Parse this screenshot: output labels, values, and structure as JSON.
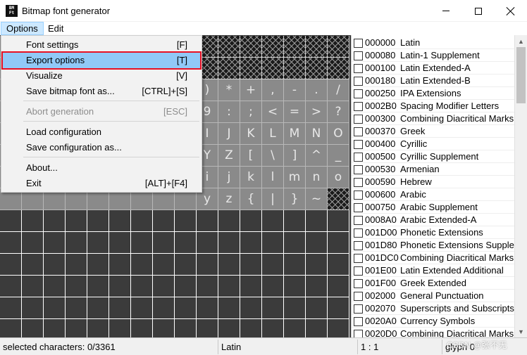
{
  "window": {
    "title": "Bitmap font generator",
    "icon_text": "BM\nFont"
  },
  "menubar": {
    "options": "Options",
    "edit": "Edit"
  },
  "dropdown": {
    "items": [
      {
        "label": "Font settings",
        "shortcut": "[F]",
        "disabled": false,
        "highlighted": false
      },
      {
        "label": "Export options",
        "shortcut": "[T]",
        "disabled": false,
        "highlighted": true
      },
      {
        "label": "Visualize",
        "shortcut": "[V]",
        "disabled": false,
        "highlighted": false
      },
      {
        "label": "Save bitmap font as...",
        "shortcut": "[CTRL]+[S]",
        "disabled": false,
        "highlighted": false
      },
      {
        "label": "Abort generation",
        "shortcut": "[ESC]",
        "disabled": true,
        "highlighted": false
      },
      {
        "label": "Load configuration",
        "shortcut": "",
        "disabled": false,
        "highlighted": false
      },
      {
        "label": "Save configuration as...",
        "shortcut": "",
        "disabled": false,
        "highlighted": false
      },
      {
        "label": "About...",
        "shortcut": "",
        "disabled": false,
        "highlighted": false
      },
      {
        "label": "Exit",
        "shortcut": "[ALT]+[F4]",
        "disabled": false,
        "highlighted": false
      }
    ]
  },
  "grid": {
    "visible_glyph_rows": [
      [
        ")",
        "*",
        "+",
        ",",
        "-",
        ".",
        "/"
      ],
      [
        "9",
        ":",
        ";",
        "<",
        "=",
        ">",
        "?"
      ],
      [
        "I",
        "J",
        "K",
        "L",
        "M",
        "N",
        "O"
      ],
      [
        "Y",
        "Z",
        "[",
        "\\",
        "]",
        "^",
        "_"
      ],
      [
        "i",
        "j",
        "k",
        "l",
        "m",
        "n",
        "o"
      ],
      [
        "y",
        "z",
        "{",
        "|",
        "}",
        "~",
        ""
      ]
    ]
  },
  "unicode_list": [
    {
      "code": "000000",
      "name": "Latin"
    },
    {
      "code": "000080",
      "name": "Latin-1 Supplement"
    },
    {
      "code": "000100",
      "name": "Latin Extended-A"
    },
    {
      "code": "000180",
      "name": "Latin Extended-B"
    },
    {
      "code": "000250",
      "name": "IPA Extensions"
    },
    {
      "code": "0002B0",
      "name": "Spacing Modifier Letters"
    },
    {
      "code": "000300",
      "name": "Combining Diacritical Marks"
    },
    {
      "code": "000370",
      "name": "Greek"
    },
    {
      "code": "000400",
      "name": "Cyrillic"
    },
    {
      "code": "000500",
      "name": "Cyrillic Supplement"
    },
    {
      "code": "000530",
      "name": "Armenian"
    },
    {
      "code": "000590",
      "name": "Hebrew"
    },
    {
      "code": "000600",
      "name": "Arabic"
    },
    {
      "code": "000750",
      "name": "Arabic Supplement"
    },
    {
      "code": "0008A0",
      "name": "Arabic Extended-A"
    },
    {
      "code": "001D00",
      "name": "Phonetic Extensions"
    },
    {
      "code": "001D80",
      "name": "Phonetic Extensions Supple..."
    },
    {
      "code": "001DC0",
      "name": "Combining Diacritical Marks"
    },
    {
      "code": "001E00",
      "name": "Latin Extended Additional"
    },
    {
      "code": "001F00",
      "name": "Greek Extended"
    },
    {
      "code": "002000",
      "name": "General Punctuation"
    },
    {
      "code": "002070",
      "name": "Superscripts and Subscripts"
    },
    {
      "code": "0020A0",
      "name": "Currency Symbols"
    },
    {
      "code": "0020D0",
      "name": "Combining Diacritical Marks"
    }
  ],
  "statusbar": {
    "selected": "selected characters: 0/3361",
    "range": "Latin",
    "zoom": "1 : 1",
    "glyph": "glyph 0"
  },
  "watermark": "CSDN @张不无"
}
